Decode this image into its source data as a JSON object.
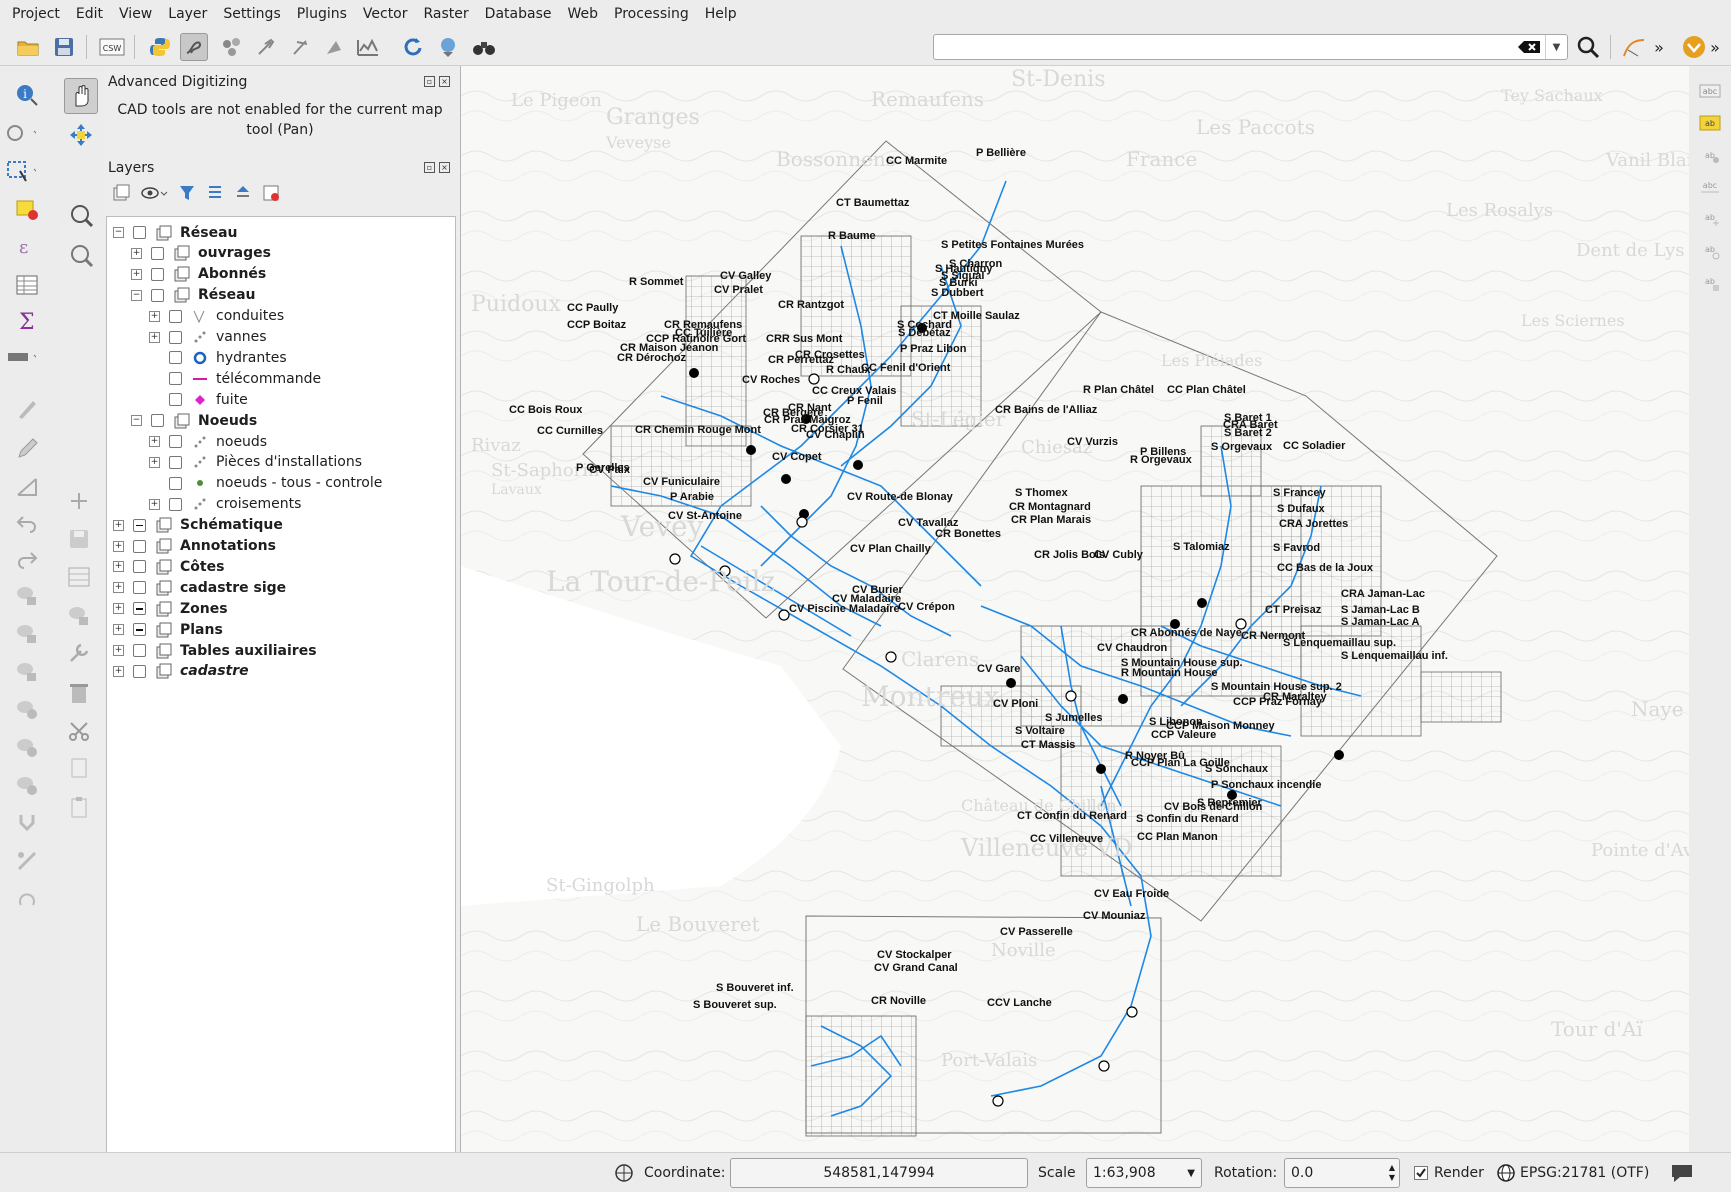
{
  "menubar": [
    "Project",
    "Edit",
    "View",
    "Layer",
    "Settings",
    "Plugins",
    "Vector",
    "Raster",
    "Database",
    "Web",
    "Processing",
    "Help"
  ],
  "toolbar": {
    "csw_label": "CSW",
    "search_value": "",
    "overflow": "»"
  },
  "advanced_digitizing": {
    "title": "Advanced Digitizing",
    "message_line1": "CAD tools are not enabled for the current map",
    "message_line2": "tool (Pan)"
  },
  "layers_panel": {
    "title": "Layers",
    "tree": [
      {
        "label": "Réseau",
        "level": 0,
        "expand": "-",
        "check": "none",
        "icon": "group",
        "style": "bold"
      },
      {
        "label": "ouvrages",
        "level": 1,
        "expand": "+",
        "check": "none",
        "icon": "group",
        "style": "bold"
      },
      {
        "label": "Abonnés",
        "level": 1,
        "expand": "+",
        "check": "none",
        "icon": "group",
        "style": "bold"
      },
      {
        "label": "Réseau",
        "level": 1,
        "expand": "-",
        "check": "none",
        "icon": "group",
        "style": "bold"
      },
      {
        "label": "conduites",
        "level": 2,
        "expand": "+",
        "check": "none",
        "icon": "line-cat",
        "style": ""
      },
      {
        "label": "vannes",
        "level": 2,
        "expand": "+",
        "check": "none",
        "icon": "point-cat",
        "style": ""
      },
      {
        "label": "hydrantes",
        "level": 2,
        "expand": "",
        "check": "none",
        "icon": "circle-blue",
        "style": ""
      },
      {
        "label": "télécommande",
        "level": 2,
        "expand": "",
        "check": "none",
        "icon": "line-magenta",
        "style": ""
      },
      {
        "label": "fuite",
        "level": 2,
        "expand": "",
        "check": "none",
        "icon": "diamond-magenta",
        "style": ""
      },
      {
        "label": "Noeuds",
        "level": 1,
        "expand": "-",
        "check": "none",
        "icon": "group",
        "style": "bold"
      },
      {
        "label": "noeuds",
        "level": 2,
        "expand": "+",
        "check": "none",
        "icon": "point-cat",
        "style": ""
      },
      {
        "label": "Pièces d'installations",
        "level": 2,
        "expand": "+",
        "check": "none",
        "icon": "point-cat",
        "style": ""
      },
      {
        "label": "noeuds - tous - controle",
        "level": 2,
        "expand": "",
        "check": "none",
        "icon": "dot-green",
        "style": ""
      },
      {
        "label": "croisements",
        "level": 2,
        "expand": "+",
        "check": "none",
        "icon": "point-cat",
        "style": ""
      },
      {
        "label": "Schématique",
        "level": 0,
        "expand": "+",
        "check": "partial",
        "icon": "group",
        "style": "bold"
      },
      {
        "label": "Annotations",
        "level": 0,
        "expand": "+",
        "check": "none",
        "icon": "group",
        "style": "bold"
      },
      {
        "label": "Côtes",
        "level": 0,
        "expand": "+",
        "check": "none",
        "icon": "group",
        "style": "bold"
      },
      {
        "label": "cadastre sige",
        "level": 0,
        "expand": "+",
        "check": "none",
        "icon": "group",
        "style": "bold"
      },
      {
        "label": "Zones",
        "level": 0,
        "expand": "+",
        "check": "partial",
        "icon": "group",
        "style": "bold"
      },
      {
        "label": "Plans",
        "level": 0,
        "expand": "+",
        "check": "partial",
        "icon": "group",
        "style": "bold"
      },
      {
        "label": "Tables auxiliaires",
        "level": 0,
        "expand": "+",
        "check": "none",
        "icon": "group",
        "style": "bold"
      },
      {
        "label": "cadastre",
        "level": 0,
        "expand": "+",
        "check": "none",
        "icon": "group",
        "style": "italic"
      }
    ]
  },
  "map": {
    "basemap_labels": [
      "Remaufens",
      "St-Denis",
      "Granges",
      "Veveyse",
      "Bossonnens",
      "Les Paccots",
      "Le Pigeon",
      "France",
      "Tey Sachaux",
      "Vanil Blanc",
      "Les Rosalys",
      "Dent de Lys",
      "Puidoux",
      "Rivaz",
      "St-Saphorin",
      "Lavaux",
      "Vevey",
      "La Tour-de-Peilz",
      "St-Légier",
      "Chiesaz",
      "Les Pléiades",
      "Clarens",
      "Montreux",
      "Château de Chillon",
      "Villeneuve VD",
      "St-Gingolph",
      "Le Bouveret",
      "Noville",
      "Port-Valais",
      "Pointe d'Aveneyre",
      "Tour d'Aï",
      "Les Sciernes",
      "Naye"
    ],
    "feature_labels": [
      "P Bellière",
      "CC Marmite",
      "CT Baumettaz",
      "R Baume",
      "S Petites Fontaines Murées",
      "S Hautigny",
      "S Charron",
      "S Burki",
      "S Sigual",
      "S Dubbert",
      "CT Moille Saulaz",
      "S Cochard",
      "S Debétaz",
      "P Praz Libon",
      "CC Fenil d'Orient",
      "R Sommet",
      "CV Galley",
      "CV Pralet",
      "CR Rantzgot",
      "CC Paully",
      "CCP Boitaz",
      "CR Remaufens",
      "CC Tuilière",
      "CCP Ratinoire Gort",
      "CR Maison Jeanon",
      "CR Dérochoz",
      "CRR Sus Mont",
      "CR Perrettaz",
      "CR Crosettes",
      "R Chaux",
      "CV Roches",
      "CC Creux Valais",
      "P Fenil",
      "CR Nant",
      "CR Bergere",
      "CR Praz Maigroz",
      "CR Corsier 31",
      "CV Chaplin",
      "CC Bois Roux",
      "CC Curnilles",
      "CR Chemin Rouge Mont",
      "CV Copet",
      "P Gerelles",
      "CV Paix",
      "CV Funiculaire",
      "P Arabie",
      "CV St-Antoine",
      "CV Route-de Blonay",
      "CV Tavallaz",
      "CR Bonettes",
      "CV Plan Chailly",
      "CV Burier",
      "CV Maladaire",
      "CV Piscine Maladaire",
      "CV Crépon",
      "R Plan Châtel",
      "CC Plan Châtel",
      "CR Bains de l'Alliaz",
      "CV Vurzis",
      "P Billens",
      "R Orgevaux",
      "S Baret 1",
      "CRA Baret",
      "S Baret 2",
      "S Orgevaux",
      "CC Soladier",
      "S Francey",
      "S Dufaux",
      "CRA Jorettes",
      "S Thomex",
      "CR Montagnard",
      "CR Plan Marais",
      "CR Jolis Bois",
      "CV Cubly",
      "S Talomiaz",
      "S Favrod",
      "CRA Jaman-Lac",
      "S Jaman-Lac B",
      "S Jaman-Lac A",
      "CC Bas de la Joux",
      "CT Preisaz",
      "S Lenquemaillau sup.",
      "S Lenquemaillau inf.",
      "CR Abonnés de Naye",
      "CR Nermont",
      "CV Gare",
      "CV Chaudron",
      "S Mountain House sup.",
      "R Mountain House",
      "S Mountain House sup. 2",
      "CCP Praz Fornay",
      "CR Maraltey",
      "CV Ploni",
      "S Jumelles",
      "S Voltaire",
      "CT Massis",
      "S Libonon",
      "CCP Maison Monney",
      "CCP Valeure",
      "R Noyer Bû",
      "CCP Plan La Goille",
      "S Sonchaux",
      "P Sonchaux incendie",
      "S Repremier",
      "CV Bois de Chillon",
      "CT Confin du Renard",
      "S Confin du Renard",
      "CC Plan Manon",
      "CC Villeneuve",
      "CV Eau Froide",
      "CV Mouniaz",
      "CV Passerelle",
      "CV Stockalper",
      "CV Grand Canal",
      "CR Noville",
      "CCV Lanche",
      "S Bouveret inf.",
      "S Bouveret sup."
    ]
  },
  "statusbar": {
    "coordinate_label": "Coordinate:",
    "coordinate_value": "548581,147994",
    "scale_label": "Scale",
    "scale_value": "1:63,908",
    "rotation_label": "Rotation:",
    "rotation_value": "0.0",
    "render_label": "Render",
    "crs_label": "EPSG:21781 (OTF)"
  },
  "colors": {
    "network": "#1e88e5",
    "accent_toolbar": "#e6a020",
    "tree_bg": "#ffffff"
  }
}
